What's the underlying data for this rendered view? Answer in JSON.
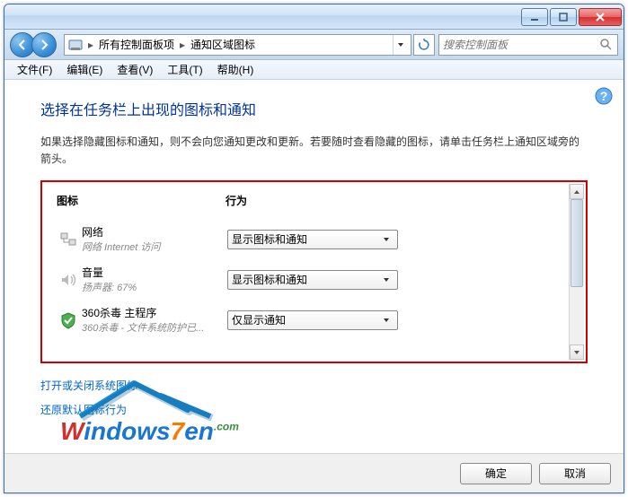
{
  "titlebar": {},
  "address": {
    "crumbs": [
      "所有控制面板项",
      "通知区域图标"
    ],
    "search_placeholder": "搜索控制面板"
  },
  "menu": {
    "items": [
      "文件(F)",
      "编辑(E)",
      "查看(V)",
      "工具(T)",
      "帮助(H)"
    ]
  },
  "page": {
    "title": "选择在任务栏上出现的图标和通知",
    "description": "如果选择隐藏图标和通知，则不会向您通知更改和更新。若要随时查看隐藏的图标，请单击任务栏上通知区域旁的箭头。"
  },
  "list": {
    "header_icon": "图标",
    "header_action": "行为",
    "rows": [
      {
        "title": "网络",
        "sub": "网络 Internet 访问",
        "action": "显示图标和通知",
        "icon": "network"
      },
      {
        "title": "音量",
        "sub": "扬声器: 67%",
        "action": "显示图标和通知",
        "icon": "volume"
      },
      {
        "title": "360杀毒 主程序",
        "sub": "360杀毒 - 文件系统防护已...",
        "action": "仅显示通知",
        "icon": "shield"
      }
    ]
  },
  "links": {
    "system_icons": "打开或关闭系统图标",
    "restore_defaults": "还原默认图标行为"
  },
  "footer": {
    "ok": "确定",
    "cancel": "取消"
  },
  "watermark": {
    "text_w": "W",
    "text_indows": "indows",
    "text_7": "7",
    "text_en": "en",
    "text_com": ".com"
  }
}
